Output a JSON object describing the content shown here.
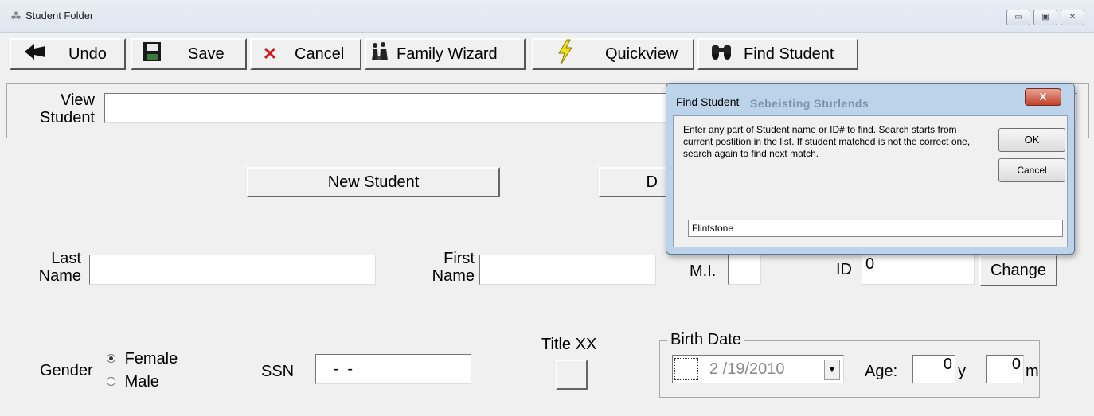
{
  "window": {
    "title": "Student Folder",
    "icon": "app-icon",
    "controls": [
      "minimize",
      "maximize",
      "close"
    ]
  },
  "toolbar": {
    "undo": {
      "label": "Undo",
      "icon": "undo-arrow-icon"
    },
    "save": {
      "label": "Save",
      "icon": "floppy-disk-icon"
    },
    "cancel": {
      "label": "Cancel",
      "icon": "red-x-icon"
    },
    "family_wizard": {
      "label": "Family Wizard",
      "icon": "family-icon"
    },
    "quickview": {
      "label": "Quickview",
      "icon": "lightning-icon"
    },
    "find_student": {
      "label": "Find Student",
      "icon": "binoculars-icon"
    }
  },
  "view_student": {
    "label_line1": "View",
    "label_line2": "Student",
    "value": ""
  },
  "buttons": {
    "new_student": "New Student",
    "hidden_button_partial": "D",
    "change": "Change"
  },
  "form": {
    "last_name": {
      "label_line1": "Last",
      "label_line2": "Name",
      "value": ""
    },
    "first_name": {
      "label_line1": "First",
      "label_line2": "Name",
      "value": ""
    },
    "mi": {
      "label": "M.I.",
      "value": ""
    },
    "id": {
      "label": "ID",
      "value": "0"
    },
    "gender": {
      "label": "Gender",
      "options": [
        "Female",
        "Male"
      ],
      "selected": "Female"
    },
    "ssn": {
      "label": "SSN",
      "value": " -  -"
    },
    "title_xx": {
      "label": "Title XX"
    },
    "birth_date": {
      "group_label": "Birth Date",
      "value": "2 /19/2010"
    },
    "age": {
      "label": "Age:",
      "years": "0",
      "years_unit": "y",
      "months": "0",
      "months_unit": "m"
    }
  },
  "dialog": {
    "title": "Find Student",
    "background_title": "Sebeisting Sturlends",
    "message": "Enter any part of Student name or ID# to find.  Search starts from current postition in the list.  If student matched is not the correct one, search again to find next match.",
    "ok": "OK",
    "cancel": "Cancel",
    "input_value": "Flintstone",
    "close_label": "X"
  },
  "colors": {
    "window_bg": "#f0f0f0",
    "dialog_frame": "#bcd3ea",
    "close_red": "#c2412b"
  }
}
